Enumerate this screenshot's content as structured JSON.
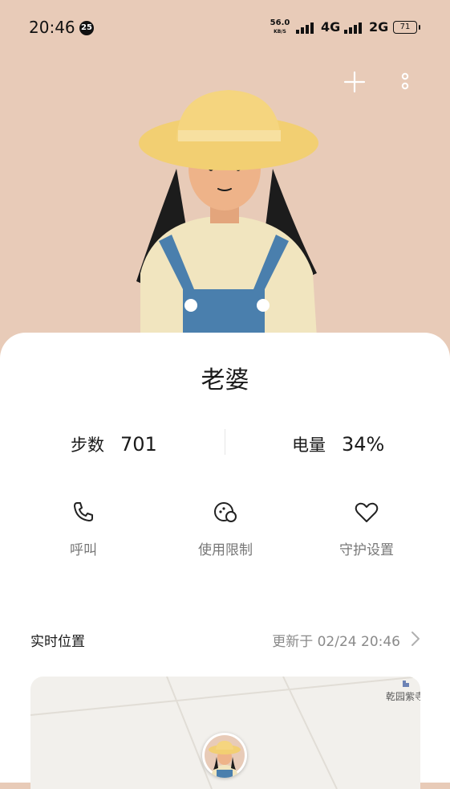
{
  "status_bar": {
    "time": "20:46",
    "notification_count": "25",
    "net_speed_value": "56.0",
    "net_speed_unit": "KB/S",
    "network1": "4G",
    "network2": "2G",
    "battery": "71"
  },
  "profile": {
    "name": "老婆"
  },
  "stats": {
    "steps_label": "步数",
    "steps_value": "701",
    "battery_label": "电量",
    "battery_value": "34%"
  },
  "actions": [
    {
      "label": "呼叫",
      "icon": "phone-icon"
    },
    {
      "label": "使用限制",
      "icon": "usage-limit-icon"
    },
    {
      "label": "守护设置",
      "icon": "heart-icon"
    }
  ],
  "location": {
    "title": "实时位置",
    "updated": "更新于 02/24 20:46",
    "map_label": "乾园紫",
    "map_label_cut": "寺"
  },
  "colors": {
    "header_bg": "#e8cbb8",
    "card_bg": "#ffffff",
    "secondary_text": "#8a8a8a"
  }
}
